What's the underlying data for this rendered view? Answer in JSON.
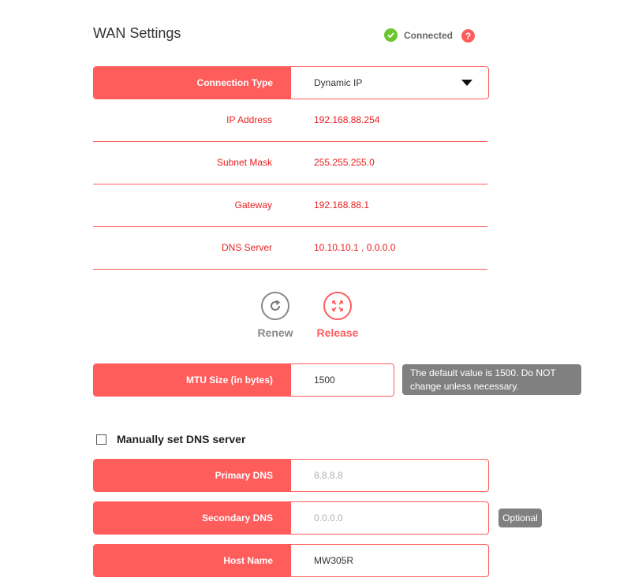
{
  "header": {
    "title": "WAN Settings",
    "status_text": "Connected",
    "help_glyph": "?",
    "status_icon": "check-circle-icon",
    "status_color": "#6cc62d"
  },
  "colors": {
    "accent": "#ff5c5c",
    "info_text": "#e8201f",
    "tooltip_bg": "#808080"
  },
  "connection": {
    "label": "Connection Type",
    "value": "Dynamic IP"
  },
  "info": [
    {
      "label": "IP Address",
      "value": "192.168.88.254"
    },
    {
      "label": "Subnet Mask",
      "value": "255.255.255.0"
    },
    {
      "label": "Gateway",
      "value": "192.168.88.1"
    },
    {
      "label": "DNS Server",
      "value": "10.10.10.1 , 0.0.0.0"
    }
  ],
  "actions": {
    "renew": "Renew",
    "release": "Release"
  },
  "mtu": {
    "label": "MTU Size (in bytes)",
    "value": "1500",
    "tooltip": "The default value is 1500. Do NOT change unless necessary."
  },
  "dns": {
    "checkbox_label": "Manually set DNS server",
    "primary_label": "Primary DNS",
    "primary_placeholder": "8.8.8.8",
    "secondary_label": "Secondary DNS",
    "secondary_placeholder": "0.0.0.0",
    "optional_badge": "Optional"
  },
  "host": {
    "label": "Host Name",
    "value": "MW305R"
  }
}
